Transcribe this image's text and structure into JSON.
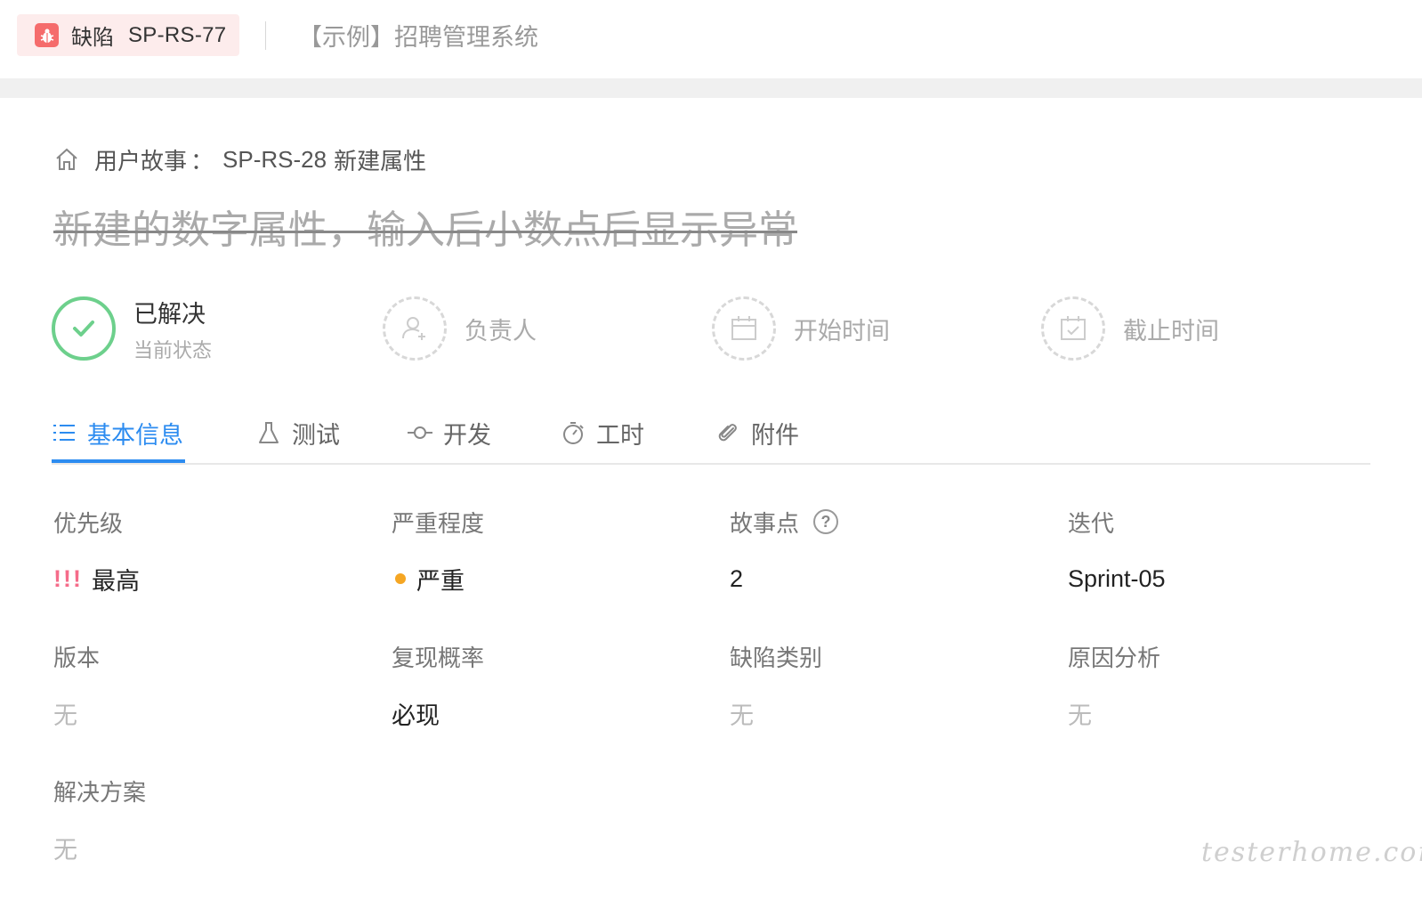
{
  "topbar": {
    "defect_type": "缺陷",
    "defect_id": "SP-RS-77",
    "project_name": "【示例】招聘管理系统",
    "brand_color": "#f56c6c"
  },
  "breadcrumb": {
    "label": "用户故事",
    "separator": "：",
    "story_id": "SP-RS-28",
    "story_title": "新建属性"
  },
  "title": "新建的数字属性，输入后小数点后显示异常",
  "status": {
    "value": "已解决",
    "label": "当前状态",
    "color": "#6dd08c"
  },
  "meta_fields": {
    "assignee": "负责人",
    "start_time": "开始时间",
    "due_time": "截止时间"
  },
  "tabs": [
    {
      "label": "基本信息",
      "icon": "list-icon",
      "active": true
    },
    {
      "label": "测试",
      "icon": "flask-icon",
      "active": false
    },
    {
      "label": "开发",
      "icon": "commit-icon",
      "active": false
    },
    {
      "label": "工时",
      "icon": "stopwatch-icon",
      "active": false
    },
    {
      "label": "附件",
      "icon": "paperclip-icon",
      "active": false
    }
  ],
  "accent_color": "#2d8cf0",
  "fields": {
    "priority": {
      "label": "优先级",
      "mark": "!!!",
      "value": "最高"
    },
    "severity": {
      "label": "严重程度",
      "value": "严重",
      "dot_color": "#f5a623"
    },
    "story_points": {
      "label": "故事点",
      "help": "?",
      "value": "2"
    },
    "iteration": {
      "label": "迭代",
      "value": "Sprint-05"
    },
    "version": {
      "label": "版本",
      "value": "无"
    },
    "reproducibility": {
      "label": "复现概率",
      "value": "必现"
    },
    "defect_category": {
      "label": "缺陷类别",
      "value": "无"
    },
    "root_cause": {
      "label": "原因分析",
      "value": "无"
    },
    "solution": {
      "label": "解决方案",
      "value": "无"
    }
  },
  "watermark": "testerhome.com"
}
